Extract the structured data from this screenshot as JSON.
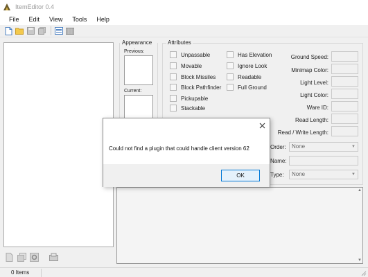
{
  "window": {
    "title": "ItemEditor 0.4"
  },
  "menu": [
    "File",
    "Edit",
    "View",
    "Tools",
    "Help"
  ],
  "toolbar_icons": [
    "new-icon",
    "open-icon",
    "save-icon",
    "save-as-icon",
    "list-icon",
    "compare-icon"
  ],
  "appearance": {
    "title": "Appearance",
    "previous_label": "Previous:",
    "current_label": "Current:"
  },
  "attributes": {
    "title": "Attributes",
    "col1": [
      "Unpassable",
      "Movable",
      "Block Missiles",
      "Block Pathfinder",
      "Pickupable",
      "Stackable"
    ],
    "col2": [
      "Has Elevation",
      "Ignore Look",
      "Readable",
      "Full Ground"
    ],
    "fields": [
      "Ground Speed:",
      "Minimap Color:",
      "Light Level:",
      "Light Color:",
      "Ware ID:",
      "Read Length:",
      "Read / Write Length:"
    ],
    "order_label": "Order:",
    "order_value": "None",
    "name_label": "Name:",
    "type_label": "Type:",
    "type_value": "None"
  },
  "status": {
    "items": "0 Items"
  },
  "dialog": {
    "message": "Could not find a plugin that could handle client version 62",
    "ok_label": "OK"
  }
}
